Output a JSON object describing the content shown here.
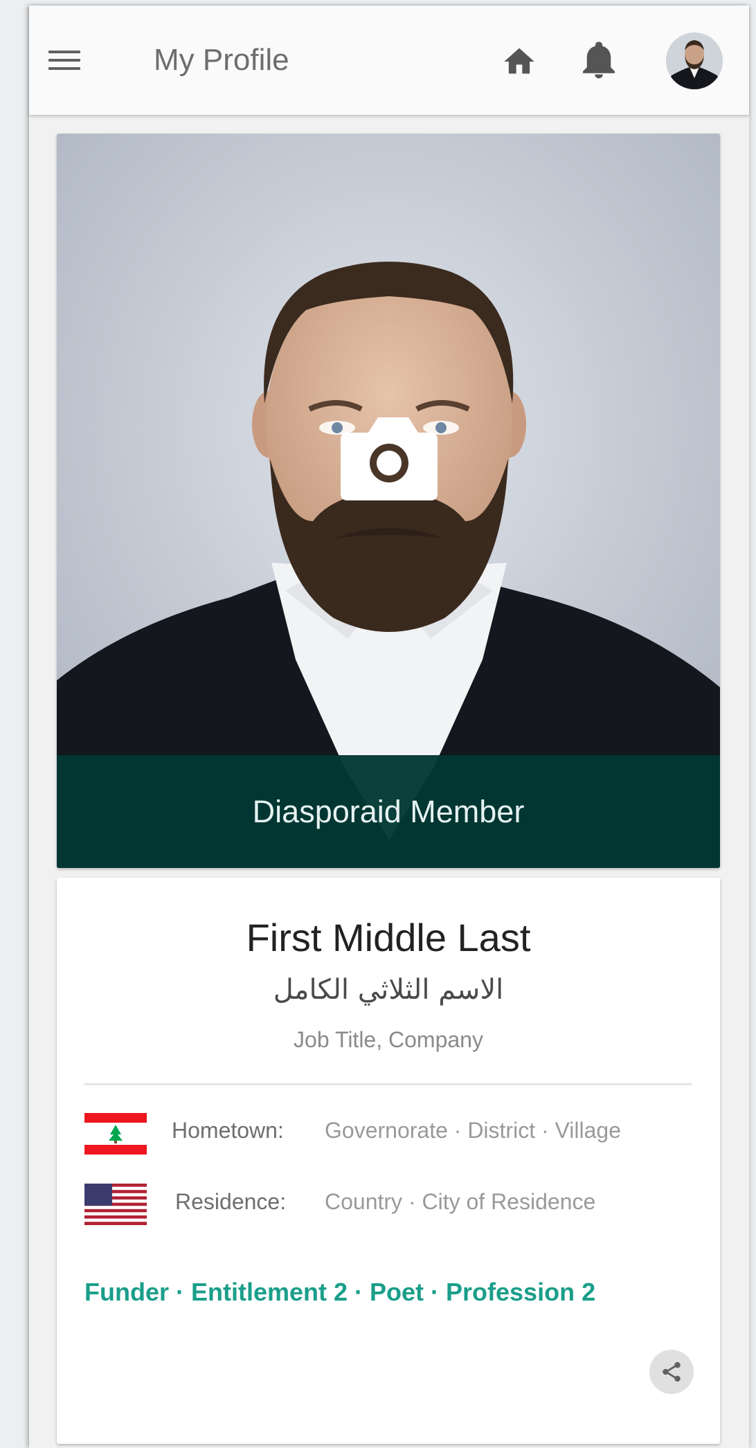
{
  "appbar": {
    "title": "My Profile",
    "icons": [
      "menu-icon",
      "home-icon",
      "bell-icon",
      "avatar"
    ]
  },
  "photo": {
    "badge": "Diasporaid Member",
    "overlay_icon": "camera-icon"
  },
  "profile": {
    "name": "First Middle Last",
    "arabic_name": "الاسم الثلاثي الكامل",
    "job": "Job Title, Company",
    "hometown": {
      "label": "Hometown:",
      "value": "Governorate · District · Village",
      "flag": "lebanon-flag-icon"
    },
    "residence": {
      "label": "Residence:",
      "value": "Country · City of Residence",
      "flag": "usa-flag-icon"
    },
    "tags": "Funder · Entitlement 2 · Poet · Profession 2",
    "share_icon": "share-icon"
  },
  "colors": {
    "accent": "#1a9e8a",
    "banner": "#01383a",
    "appbar": "#fafafa",
    "background": "#f1f1f1"
  }
}
